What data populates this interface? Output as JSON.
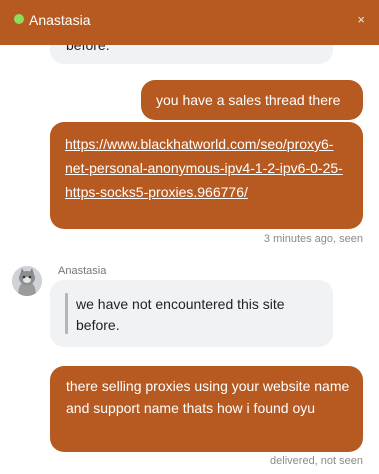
{
  "header": {
    "title": "Anastasia",
    "close_label": "×",
    "status_color": "#8dde5a",
    "accent_color": "#b65a21"
  },
  "messages": {
    "clipped_incoming": "before.",
    "out_1": "you have a sales thread there",
    "out_2_link": "https://www.blackhatworld.com/seo/proxy6-net-personal-anonymous-ipv4-1-2-ipv6-0-25-https-socks5-proxies.966776/",
    "receipt_1": "3 minutes ago, seen",
    "sender_name": "Anastasia",
    "in_quote": "we have not encountered this site before.",
    "out_3": "there selling proxies using your website name and support name thats how i found oyu",
    "receipt_2": "delivered, not seen"
  },
  "avatar": {
    "icon": "cat-avatar-icon"
  }
}
